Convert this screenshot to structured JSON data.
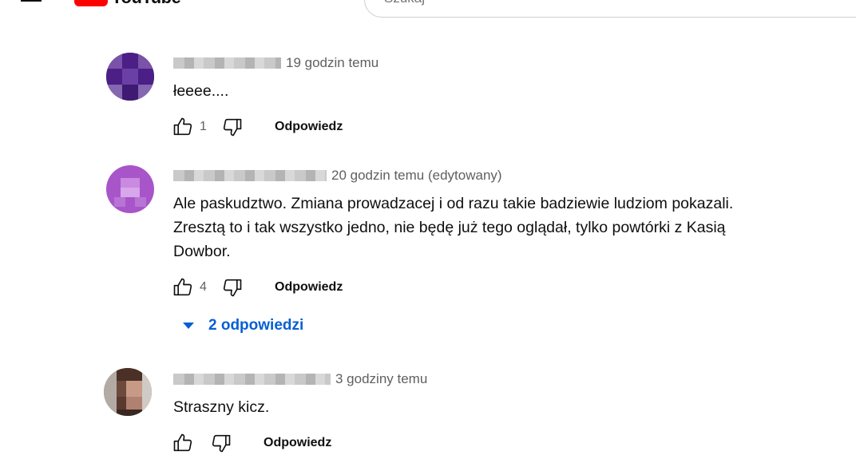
{
  "header": {
    "logo_text": "YouTube",
    "search_placeholder": "Szukaj"
  },
  "comments": [
    {
      "timestamp": "19 godzin temu",
      "text": "łeeee....",
      "likes": "1",
      "reply_label": "Odpowiedz"
    },
    {
      "timestamp": "20 godzin temu (edytowany)",
      "text": "Ale paskudztwo. Zmiana prowadzacej i od razu takie badziewie ludziom pokazali.\nZresztą to i tak wszystko jedno, nie będę już tego oglądał, tylko powtórki z Kasią\nDowbor.",
      "likes": "4",
      "reply_label": "Odpowiedz",
      "replies_label": "2 odpowiedzi"
    },
    {
      "timestamp": "3 godziny temu",
      "text": "Straszny kicz.",
      "likes": "",
      "reply_label": "Odpowiedz"
    }
  ],
  "colors": {
    "link": "#065fd4",
    "secondary_text": "#606060",
    "brand_red": "#ff0000"
  }
}
